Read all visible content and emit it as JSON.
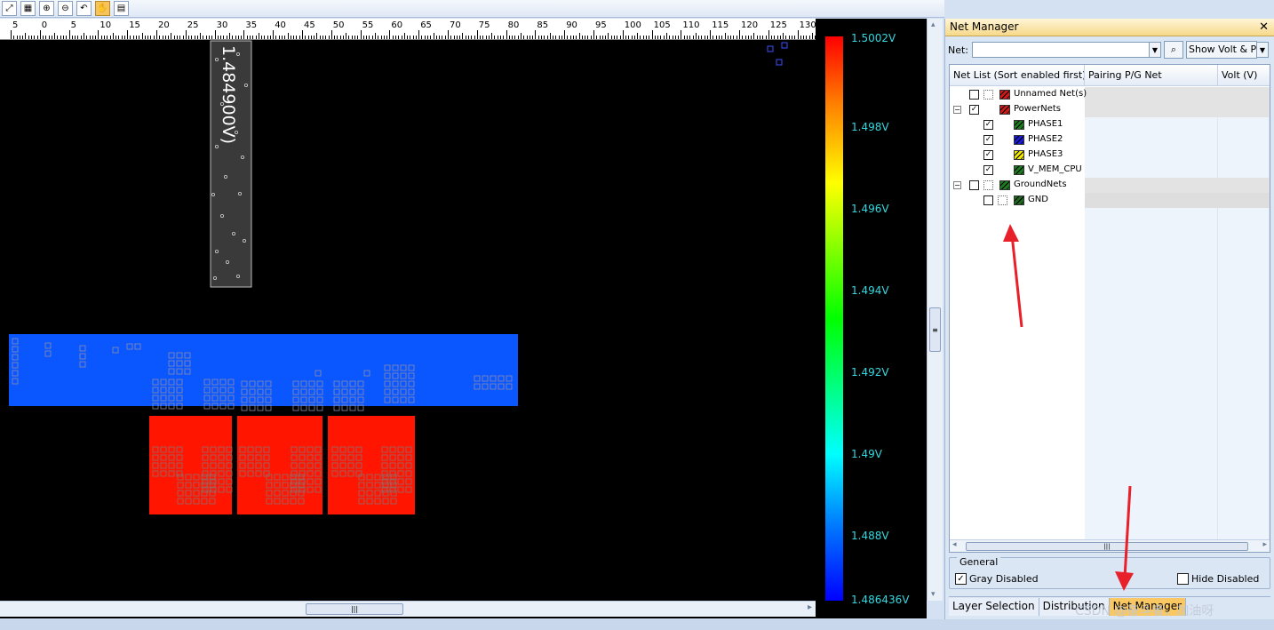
{
  "toolbar": {
    "buttons": [
      {
        "icon": "zoom-fit-icon"
      },
      {
        "icon": "zoom-region-icon"
      },
      {
        "icon": "zoom-in-icon"
      },
      {
        "icon": "zoom-out-icon"
      },
      {
        "icon": "zoom-previous-icon"
      },
      {
        "icon": "pan-icon",
        "active": true
      },
      {
        "icon": "report-icon"
      }
    ]
  },
  "ruler": {
    "ticks": [
      "5",
      "0",
      "5",
      "10",
      "15",
      "20",
      "25",
      "30",
      "35",
      "40",
      "45",
      "50",
      "55",
      "60",
      "65",
      "70",
      "75",
      "80",
      "85",
      "90",
      "95",
      "100",
      "105",
      "110",
      "115",
      "120",
      "125",
      "130"
    ]
  },
  "canvas": {
    "probe_label": "1.484900V)"
  },
  "legend": {
    "labels": [
      "1.5002V",
      "1.498V",
      "1.496V",
      "1.494V",
      "1.492V",
      "1.49V",
      "1.488V",
      "1.486436V"
    ]
  },
  "net_manager": {
    "title": "Net Manager",
    "net_label": "Net:",
    "net_value": "",
    "show_value": "Show Volt & P/G",
    "columns": [
      "Net List (Sort enabled first)",
      "Pairing P/G Net",
      "Volt (V)"
    ],
    "rows": [
      {
        "label": "Unnamed Net(s)",
        "checked": false,
        "level": 0,
        "expander": "",
        "color": "#cc1a1a",
        "kind": "grp"
      },
      {
        "label": "PowerNets",
        "checked": true,
        "level": 0,
        "expander": "−",
        "color": "#cc1a1a",
        "kind": "grp"
      },
      {
        "label": "PHASE1",
        "checked": true,
        "level": 1,
        "expander": "",
        "color": "#1e7a1e",
        "kind": "net"
      },
      {
        "label": "PHASE2",
        "checked": true,
        "level": 1,
        "expander": "",
        "color": "#1a1ad4",
        "kind": "net"
      },
      {
        "label": "PHASE3",
        "checked": true,
        "level": 1,
        "expander": "",
        "color": "#f0e800",
        "kind": "net"
      },
      {
        "label": "V_MEM_CPU",
        "checked": true,
        "level": 1,
        "expander": "",
        "color": "#1e7a1e",
        "kind": "net"
      },
      {
        "label": "GroundNets",
        "checked": false,
        "level": 0,
        "expander": "−",
        "color": "#1e7a1e",
        "kind": "grp"
      },
      {
        "label": "GND",
        "checked": false,
        "level": 1,
        "expander": "",
        "color": "#1e6a1e",
        "kind": "sub"
      }
    ],
    "general": {
      "label": "General",
      "gray_disabled": {
        "label": "Gray Disabled",
        "checked": true
      },
      "hide_disabled": {
        "label": "Hide Disabled",
        "checked": false
      }
    },
    "tabs": [
      {
        "label": "Layer Selection",
        "active": false
      },
      {
        "label": "Distribution",
        "active": false
      },
      {
        "label": "Net Manager",
        "active": true
      }
    ]
  },
  "watermark": "CSDN @奋斗者，加油呀",
  "colors": {
    "accent_tab": "#f9c862",
    "arrow": "#e8202a",
    "hot": "#ff1a00",
    "cold": "#0a5cff"
  }
}
